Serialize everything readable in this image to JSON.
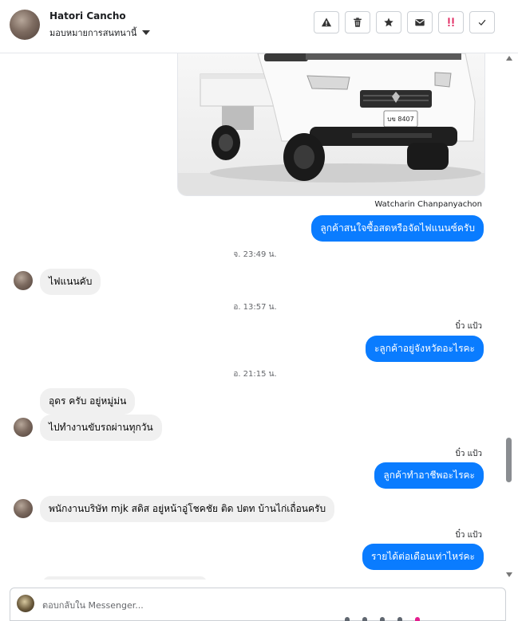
{
  "header": {
    "contact_name": "Hatori Cancho",
    "assign_label": "มอบหมายการสนทนานี้",
    "actions": [
      "report-icon",
      "trash-icon",
      "star-icon",
      "envelope-icon",
      "spam-icon",
      "check-icon"
    ]
  },
  "messages": {
    "photo_caption_plate": "บข 8407",
    "photo_sender": "Watcharin Chanpanyachon",
    "out_1": "ลูกค้าสนใจซื้อสดหรือจัดไฟแนนซ์ครับ",
    "time_1": "จ. 23:49 น.",
    "in_1": "ไฟแนนคับ",
    "time_2": "อ. 13:57 น.",
    "sender_2": "บิ๋ว แป้ว",
    "out_2": "ะลูกค้าอยู่จังหวัดอะไรคะ",
    "time_3": "อ. 21:15 น.",
    "in_2": "อุดร ครับ อยู่หมู่ม่น",
    "in_3": "ไปทำงานขับรถผ่านทุกวัน",
    "sender_3": "บิ๋ว แป้ว",
    "out_3": "ลูกค้าทำอาชีพอะไรคะ",
    "in_4": "พนักงานบริษัท mjk สดิส อยู่หน้าอู่โชคชัย ติด ปตท  บ้านไก่เถื่อนครับ",
    "sender_4": "บิ๋ว แป้ว",
    "out_4": "รายได้ต่อเดือนเท่าไหร่คะ"
  },
  "composer": {
    "placeholder": "ตอบกลับใน Messenger..."
  },
  "colors": {
    "accent": "#0a7cff",
    "incoming_bubble": "#f0f0f0",
    "spam_icon": "#e0245e"
  }
}
